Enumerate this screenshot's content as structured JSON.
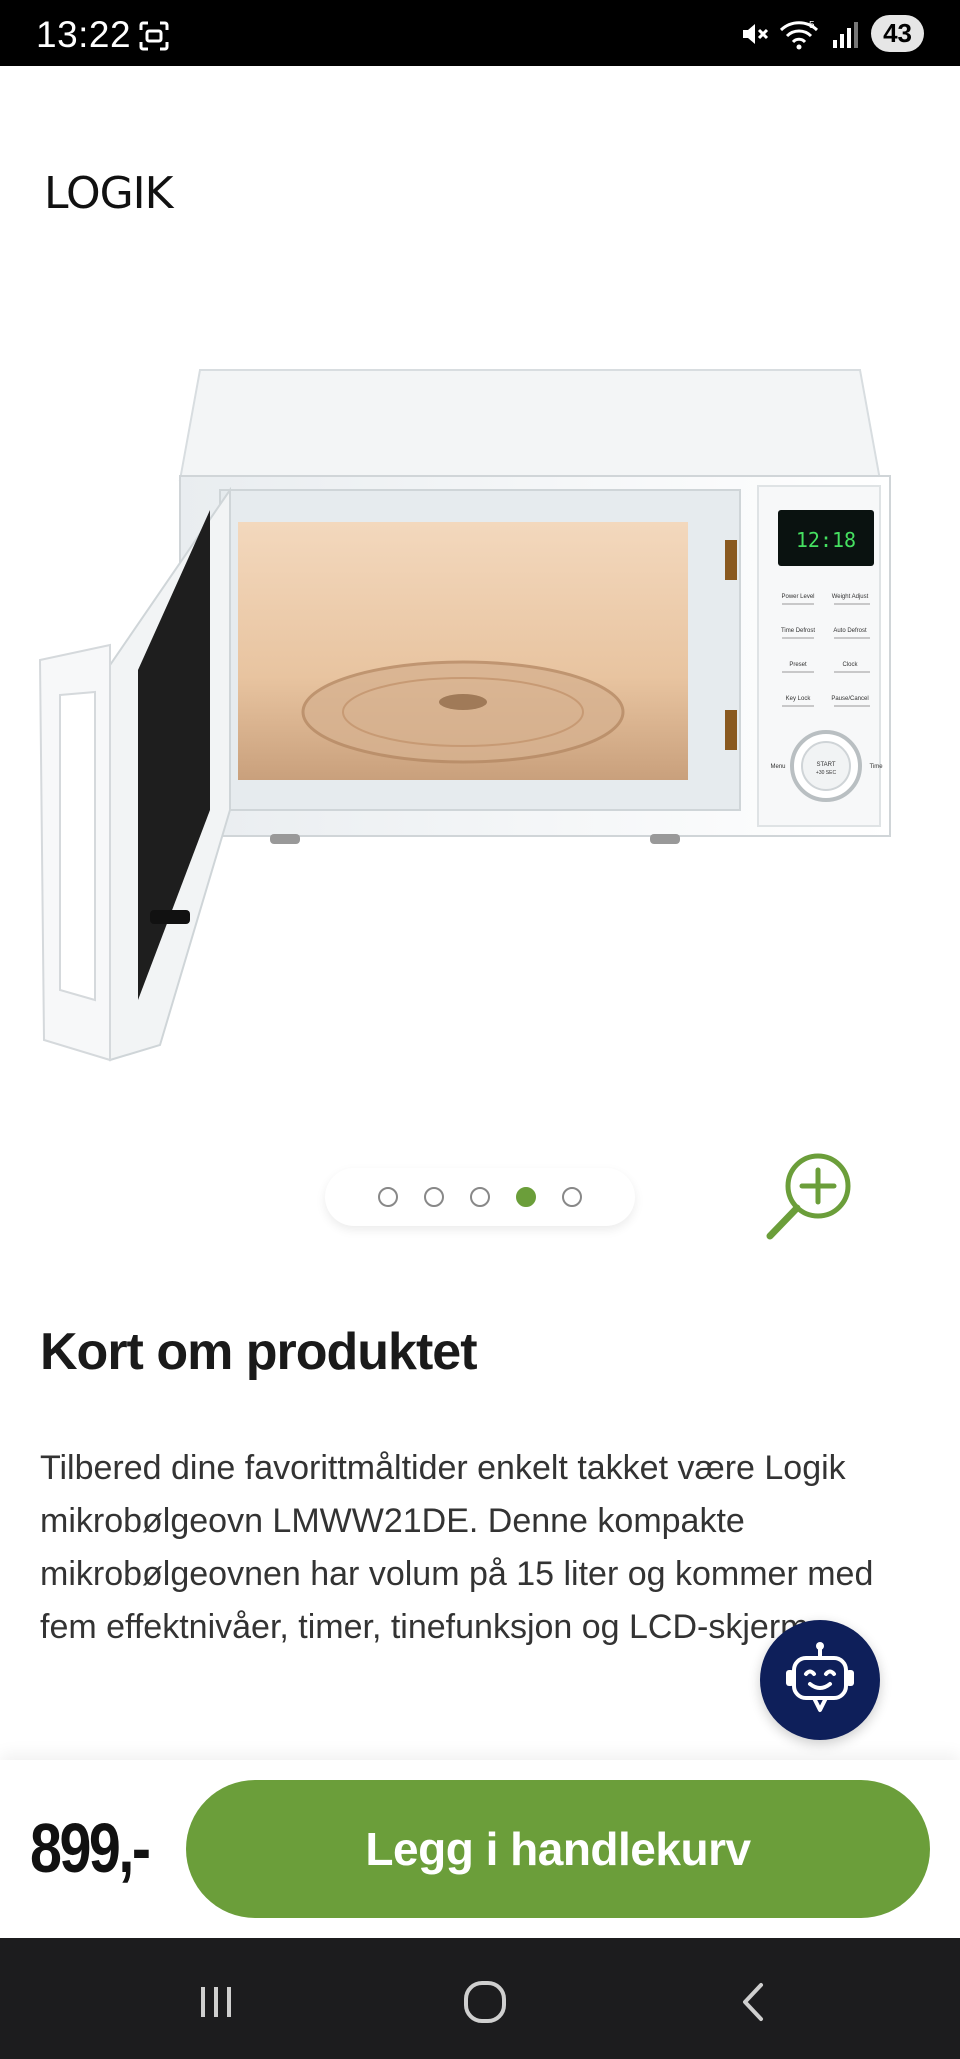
{
  "status_bar": {
    "time": "13:22",
    "battery": "43",
    "wifi_label": "5"
  },
  "brand": {
    "logo_text": "LOGIK"
  },
  "gallery": {
    "image_alt": "Logik mikrobølgeovn LMWW21DE",
    "display_time": "12:18",
    "dots": [
      {
        "active": false
      },
      {
        "active": false
      },
      {
        "active": false
      },
      {
        "active": true
      },
      {
        "active": false
      }
    ],
    "panel_labels": [
      "Power Level",
      "Weight Adjust",
      "Time Defrost",
      "Auto Defrost",
      "Preset",
      "Clock",
      "Key Lock",
      "Pause/Cancel",
      "START",
      "+30 SEC",
      "Menu",
      "Time"
    ]
  },
  "section": {
    "title": "Kort om produktet",
    "description": "Tilbered dine favorittmåltider enkelt takket være Logik mikrobølgeovn LMWW21DE. Denne kompakte mikrobølgeovnen har volum på 15 liter og kommer med fem effektnivåer, timer, tinefunksjon og LCD-skjerm."
  },
  "purchase": {
    "price": "899,-",
    "cart_button": "Legg i handlekurv"
  },
  "colors": {
    "accent_green": "#6b9e3a",
    "chat_navy": "#0e1f5a"
  }
}
